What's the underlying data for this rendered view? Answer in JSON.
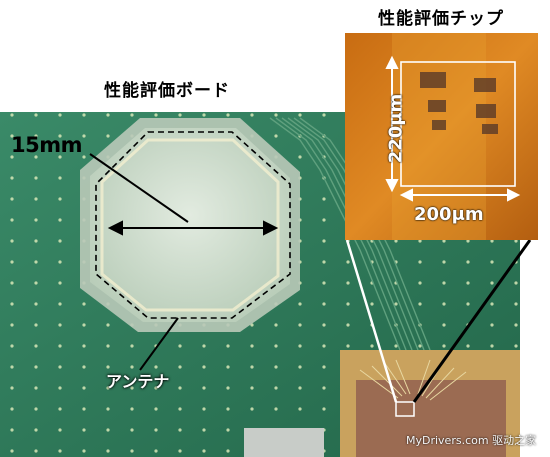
{
  "labels": {
    "board_title": "性能評価ボード",
    "chip_title": "性能評価チップ",
    "antenna_diameter": "15mm",
    "antenna": "アンテナ",
    "chip_height": "220μm",
    "chip_width": "200μm",
    "watermark": "MyDrivers.com 驱动之家"
  },
  "colors": {
    "board_green": "#2f7a5a",
    "board_dark": "#1e5a40",
    "antenna_fill": "#cfdccd",
    "chip_orange": "#d87a1a",
    "chip_gold": "#c9a25e"
  }
}
